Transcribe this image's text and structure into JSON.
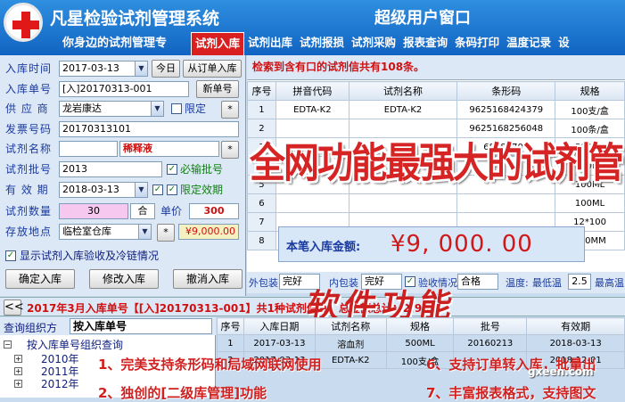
{
  "header": {
    "app_title": "凡星检验试剂管理系统",
    "slogan": "你身边的试剂管理专",
    "window_title": "超级用户窗口"
  },
  "nav": {
    "tabs": [
      "试剂入库",
      "试剂出库",
      "试剂报损",
      "试剂采购",
      "报表查询",
      "条码打印",
      "温度记录",
      "设"
    ],
    "active": "试剂入库"
  },
  "form": {
    "date_label": "入库时间",
    "date_value": "2017-03-13",
    "today_button": "今日",
    "from_order_button": "从订单入库",
    "order_label": "入库单号",
    "order_value": "[入]20170313-001",
    "new_order_button": "新单号",
    "supplier_label": "供 应 商",
    "supplier_value": "龙岩康达",
    "limit_label": "限定",
    "star": "*",
    "invoice_label": "发票号码",
    "invoice_value": "20170313101",
    "name_label": "试剂名称",
    "name_value": "稀释液",
    "batch_label": "试剂批号",
    "batch_value": "2013",
    "batch_required_label": "必输批号",
    "expiry_label": "有 效 期",
    "expiry_value": "2018-03-13",
    "expiry_limit_label": "限定效期",
    "qty_label": "试剂数量",
    "qty_value": "30",
    "unit": "合",
    "price_label": "单价",
    "price_value": "300",
    "location_label": "存放地点",
    "location_value": "临检室仓库",
    "amount_value": "¥9,000.00",
    "show_check_label": "显示试剂入库验收及冷链情况",
    "confirm_button": "确定入库",
    "modify_button": "修改入库",
    "cancel_button": "撤消入库"
  },
  "grid": {
    "message": "检索到含有口的试剂信共有108条。",
    "columns": [
      "序号",
      "拼音代码",
      "试剂名称",
      "条形码",
      "规格"
    ],
    "rows": [
      [
        "1",
        "EDTA-K2",
        "EDTA-K2",
        "9625168424379",
        "100支/盒"
      ],
      [
        "2",
        "",
        "",
        "9625168256048",
        "100条/盒"
      ],
      [
        "3",
        "",
        "",
        "68288704",
        "500ML"
      ],
      [
        "4",
        "",
        "",
        "",
        "100ML"
      ],
      [
        "5",
        "",
        "",
        "",
        "100ML"
      ],
      [
        "6",
        "",
        "",
        "",
        "100ML"
      ],
      [
        "7",
        "",
        "",
        "",
        "12*100"
      ],
      [
        "8",
        "",
        "",
        "",
        "500MM"
      ]
    ],
    "overlay_text": "全网功能最强大的试剂管"
  },
  "total": {
    "label": "本笔入库金额:",
    "value": "¥9, 000. 00"
  },
  "toolbar": {
    "outer_label": "外包装",
    "outer_value": "完好",
    "inner_label": "内包装",
    "inner_value": "完好",
    "inspect_label": "验收情况",
    "inspect_value": "合格",
    "temp_label": "温度:",
    "min_label": "最低温",
    "min_value": "2.5",
    "max_label": "最高温"
  },
  "bottom_bar": {
    "collapse": "<<",
    "message": "2017年3月入库单号【[入]20170313-001】共1种试剂信息，总金额总计：",
    "total_suffix": "2,980.",
    "watermark": "软件功能"
  },
  "tree": {
    "head_label": "查询组织方",
    "head_value": "按入库单号",
    "root": "按入库单号组织查询",
    "years": [
      "2010年",
      "2011年",
      "2012年"
    ]
  },
  "bottom_table": {
    "columns": [
      "序号",
      "入库日期",
      "试剂名称",
      "规格",
      "批号",
      "有效期"
    ],
    "rows": [
      [
        "1",
        "2017-03-13",
        "溶血剂",
        "500ML",
        "20160213",
        "2018-03-13"
      ],
      [
        "2",
        "2017-03-13",
        "EDTA-K2",
        "100支/盒",
        "",
        "2018-12-01"
      ]
    ]
  },
  "features": [
    "1、完美支持条形码和局域网联网使用",
    "6、支持订单转入库，批量出",
    "2、独创的[二级库管理]功能",
    "7、丰富报表格式，支持图文"
  ],
  "site_mark": "gxeen.com"
}
